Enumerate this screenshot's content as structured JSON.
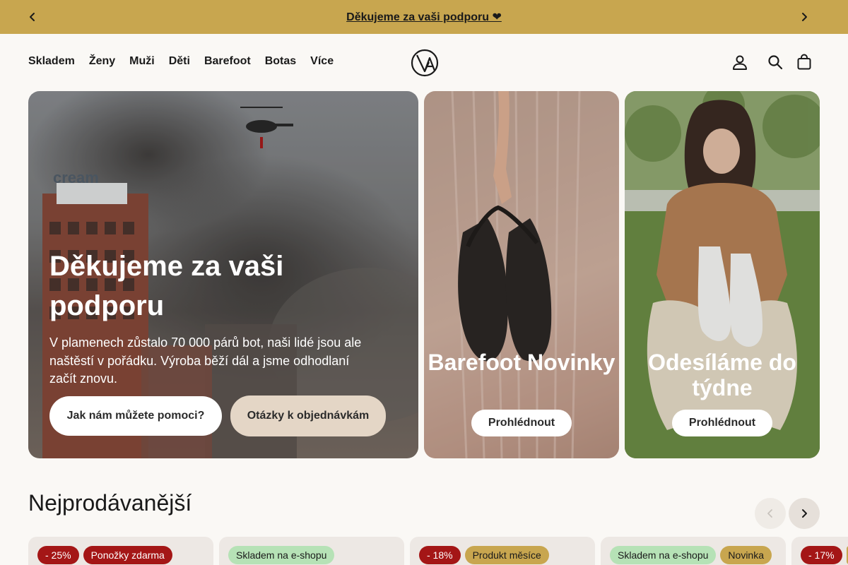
{
  "announcement": {
    "text": "Děkujeme za vaši podporu ❤"
  },
  "nav": {
    "items": [
      "Skladem ",
      "Ženy",
      "Muži",
      "Děti",
      "Barefoot",
      "Botas",
      "Více"
    ]
  },
  "hero": {
    "title": "Děkujeme za vaši podporu",
    "subtitle": "V plamenech zůstalo 70 000 párů bot, naši lidé jsou ale naštěstí v pořádku. Výroba běží dál a jsme odhodlaní začít znovu.",
    "primary_button": "Jak nám můžete pomoci?",
    "secondary_button": "Otázky k objednávkám",
    "building_sign": "cream"
  },
  "cards": [
    {
      "title": "Barefoot Novinky",
      "button": "Prohlédnout"
    },
    {
      "title": "Odesíláme do týdne",
      "button": "Prohlédnout"
    }
  ],
  "section": {
    "title": "Nejprodávanější"
  },
  "products": [
    {
      "badges": [
        {
          "text": "- 25%",
          "tone": "red"
        },
        {
          "text": " Ponožky zdarma",
          "tone": "red"
        }
      ]
    },
    {
      "badges": [
        {
          "text": "Skladem na e-shopu",
          "tone": "green"
        }
      ]
    },
    {
      "badges": [
        {
          "text": "- 18%",
          "tone": "red"
        },
        {
          "text": "Produkt měsíce",
          "tone": "gold"
        }
      ]
    },
    {
      "badges": [
        {
          "text": "Skladem na e-shopu",
          "tone": "green"
        },
        {
          "text": "Novinka",
          "tone": "gold"
        }
      ]
    },
    {
      "badges": [
        {
          "text": "- 17%",
          "tone": "red"
        },
        {
          "text": "",
          "tone": "gold"
        }
      ]
    }
  ],
  "colors": {
    "announcement_bg": "#c8a64f",
    "badge_red": "#a41616",
    "badge_green": "#b6e2b6",
    "badge_gold": "#c8a64f"
  },
  "icons": [
    "chevron-left-icon",
    "chevron-right-icon",
    "brand-logo",
    "user-icon",
    "search-icon",
    "bag-icon"
  ]
}
